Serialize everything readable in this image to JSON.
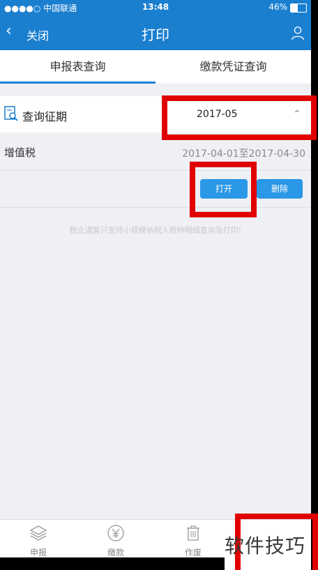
{
  "status_bar": {
    "carrier": "●●●●○ 中国联通",
    "time": "13:48",
    "battery": "46%",
    "battery_level": 0.46
  },
  "nav": {
    "back_label": "关闭",
    "title": "打印"
  },
  "tabs": [
    {
      "label": "申报表查询"
    },
    {
      "label": "缴款凭证查询"
    }
  ],
  "query": {
    "label": "查询征期",
    "period": "2017-05"
  },
  "record": {
    "tax_name": "增值税",
    "range": "2017-04-01至2017-04-30"
  },
  "actions": {
    "open_label": "打开",
    "delete_label": "删除"
  },
  "note": "税企通暂只支持小规模纳税人税种明细查询及打印!",
  "bottom_tabs": [
    {
      "label": "申报",
      "icon": "layers-icon"
    },
    {
      "label": "缴款",
      "icon": "yen-icon"
    },
    {
      "label": "作废",
      "icon": "trash-icon"
    }
  ],
  "watermark": "软件技巧",
  "colors": {
    "brand_blue": "#1b7fd0",
    "button_blue": "#2a97e7",
    "highlight_red": "#e00000"
  }
}
